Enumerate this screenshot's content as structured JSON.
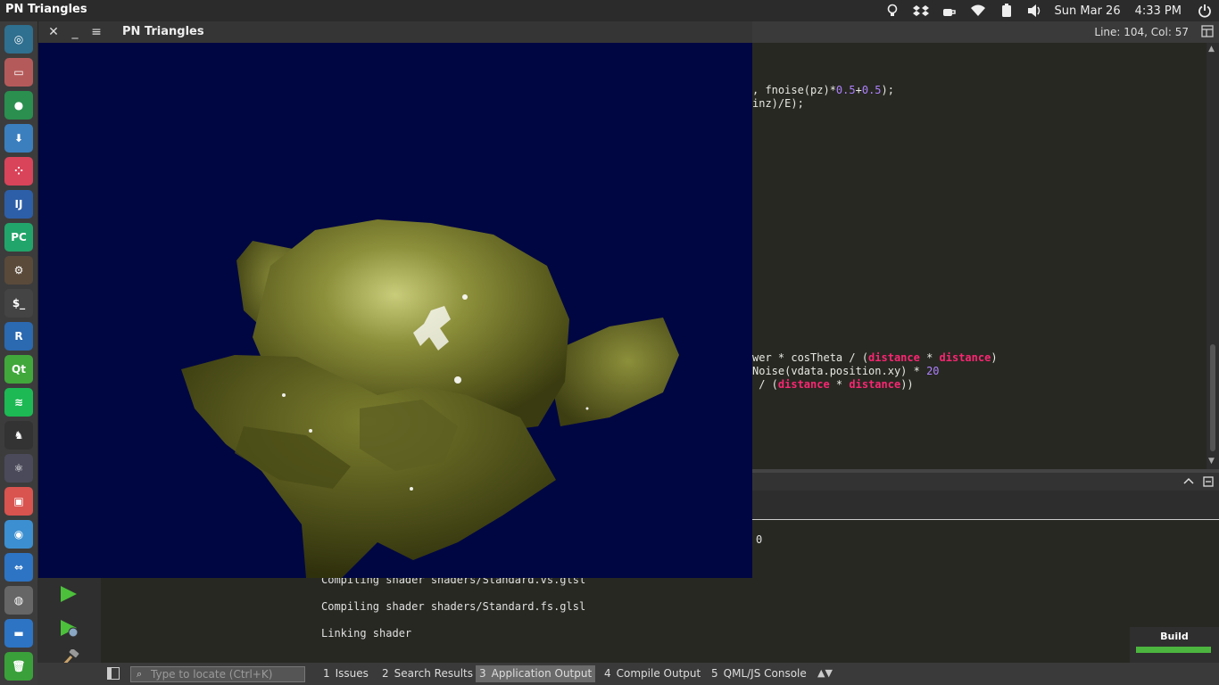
{
  "topbar": {
    "app_name": "PN Triangles",
    "date": "Sun Mar 26",
    "time": "4:33 PM",
    "tray_icons": [
      "lightbulb-icon",
      "dropbox-icon",
      "caffeine-icon",
      "wifi-icon",
      "battery-icon",
      "volume-icon",
      "power-icon"
    ]
  },
  "launcher": {
    "apps": [
      {
        "name": "dash-icon",
        "glyph": "◎",
        "color": "#2f6f8f"
      },
      {
        "name": "files-icon",
        "glyph": "▭",
        "color": "#b55a5a"
      },
      {
        "name": "chrome-icon",
        "glyph": "●",
        "color": "#2a8f4f"
      },
      {
        "name": "software-center-icon",
        "glyph": "⬇",
        "color": "#3b7fbf"
      },
      {
        "name": "dots-app-icon",
        "glyph": "⁘",
        "color": "#d9445a"
      },
      {
        "name": "intellij-icon",
        "glyph": "IJ",
        "color": "#2d5fa8"
      },
      {
        "name": "pycharm-icon",
        "glyph": "PC",
        "color": "#22a56a"
      },
      {
        "name": "settings-gear-icon",
        "glyph": "⚙",
        "color": "#5a4a3a"
      },
      {
        "name": "terminal-icon",
        "glyph": "$_",
        "color": "#444444"
      },
      {
        "name": "r-icon",
        "glyph": "R",
        "color": "#2b69b0"
      },
      {
        "name": "qt-creator-icon",
        "glyph": "Qt",
        "color": "#41a83c"
      },
      {
        "name": "spotify-icon",
        "glyph": "≋",
        "color": "#1db954"
      },
      {
        "name": "cow-app-icon",
        "glyph": "♞",
        "color": "#333333"
      },
      {
        "name": "atom-icon",
        "glyph": "⚛",
        "color": "#4a4a5a"
      },
      {
        "name": "photo-app-icon",
        "glyph": "▣",
        "color": "#d9534f"
      },
      {
        "name": "system-settings-icon",
        "glyph": "◉",
        "color": "#3c8fd0"
      },
      {
        "name": "remote-desktop-icon",
        "glyph": "⇔",
        "color": "#2d74c4"
      },
      {
        "name": "disk-icon",
        "glyph": "◍",
        "color": "#666666"
      },
      {
        "name": "workspace-icon",
        "glyph": "▬",
        "color": "#2d74c4"
      },
      {
        "name": "trash-icon",
        "glyph": "🗑",
        "color": "#3aa03a"
      }
    ]
  },
  "ide": {
    "cursor_position": "Line: 104, Col: 57",
    "code_lines": [
      {
        "parts": [
          {
            "t": ", fnoise(pz)*",
            "c": ""
          },
          {
            "t": "0.5",
            "c": "num"
          },
          {
            "t": "+",
            "c": ""
          },
          {
            "t": "0.5",
            "c": "num"
          },
          {
            "t": ");",
            "c": ""
          }
        ]
      },
      {
        "parts": [
          {
            "t": "inz)/E);",
            "c": ""
          }
        ]
      },
      {
        "parts": [
          {
            "t": "wer * cosTheta / (",
            "c": ""
          },
          {
            "t": "distance",
            "c": "kw"
          },
          {
            "t": " * ",
            "c": ""
          },
          {
            "t": "distance",
            "c": "kw"
          },
          {
            "t": ")",
            "c": ""
          }
        ]
      },
      {
        "parts": [
          {
            "t": "Noise(vdata.position.xy) * ",
            "c": ""
          },
          {
            "t": "20",
            "c": "num"
          }
        ]
      },
      {
        "parts": [
          {
            "t": " / (",
            "c": ""
          },
          {
            "t": "distance",
            "c": "kw"
          },
          {
            "t": " * ",
            "c": ""
          },
          {
            "t": "distance",
            "c": "kw"
          },
          {
            "t": "))",
            "c": ""
          }
        ]
      }
    ],
    "output_lines": [
      "0",
      "Compiling shader shaders/Standard.vs.glsl",
      "Compiling shader shaders/Standard.fs.glsl",
      "Linking shader"
    ]
  },
  "app_window": {
    "title": "PN Triangles",
    "close": "✕",
    "minimize": "_",
    "menu": "≡"
  },
  "statusbar": {
    "locator_placeholder": "Type to locate (Ctrl+K)",
    "tabs": [
      {
        "num": "1",
        "label": "Issues",
        "active": false
      },
      {
        "num": "2",
        "label": "Search Results",
        "active": false
      },
      {
        "num": "3",
        "label": "Application Output",
        "active": true
      },
      {
        "num": "4",
        "label": "Compile Output",
        "active": false
      },
      {
        "num": "5",
        "label": "QML/JS Console",
        "active": false
      }
    ]
  },
  "build": {
    "label": "Build",
    "progress": 1.0,
    "color": "#4cb53f"
  }
}
